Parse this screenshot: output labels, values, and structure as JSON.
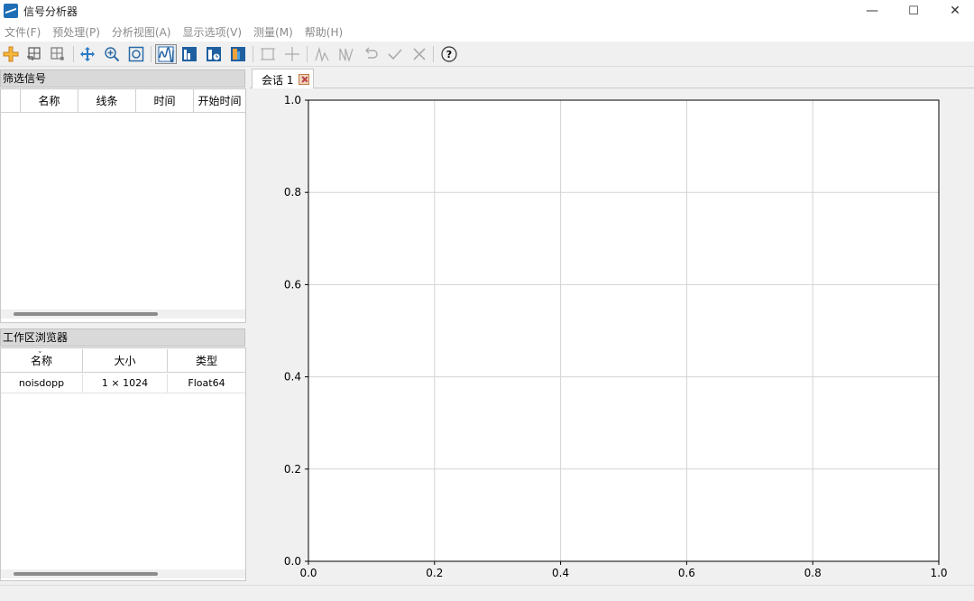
{
  "window": {
    "title": "信号分析器",
    "minimize": "—",
    "maximize": "☐",
    "close": "✕"
  },
  "menu": [
    "文件(F)",
    "预处理(P)",
    "分析视图(A)",
    "显示选项(V)",
    "测量(M)",
    "帮助(H)"
  ],
  "toolbar": {
    "buttons": [
      "add-icon",
      "import-icon",
      "export-icon",
      "pan-icon",
      "zoom-in-icon",
      "zoom-fit-icon",
      "signal-view-icon",
      "spectrum-view-icon",
      "time-frequency-view-icon",
      "persistence-view-icon",
      "data-cursor-icon",
      "crosshair-icon",
      "peak-up-icon",
      "peak-down-icon",
      "undo-icon",
      "accept-icon",
      "reject-icon",
      "help-icon"
    ],
    "help_glyph": "?"
  },
  "signals_panel": {
    "title": "筛选信号",
    "columns": [
      "名称",
      "线条",
      "时间",
      "开始时间"
    ]
  },
  "workspace_panel": {
    "title": "工作区浏览器",
    "columns": [
      "名称",
      "大小",
      "类型"
    ],
    "rows": [
      {
        "name": "noisdopp",
        "size": "1 × 1024",
        "type": "Float64"
      }
    ]
  },
  "tab": {
    "label": "会话 1"
  },
  "chart_data": {
    "type": "line",
    "title": "",
    "xlabel": "",
    "ylabel": "",
    "xlim": [
      0.0,
      1.0
    ],
    "ylim": [
      0.0,
      1.0
    ],
    "xticks": [
      "0.0",
      "0.2",
      "0.4",
      "0.6",
      "0.8",
      "1.0"
    ],
    "yticks": [
      "0.0",
      "0.2",
      "0.4",
      "0.6",
      "0.8",
      "1.0"
    ],
    "grid": true,
    "series": []
  },
  "colors": {
    "accent": "#1e6fb5",
    "menu_text": "#8a8a8a",
    "grid": "#d3d3d3"
  }
}
